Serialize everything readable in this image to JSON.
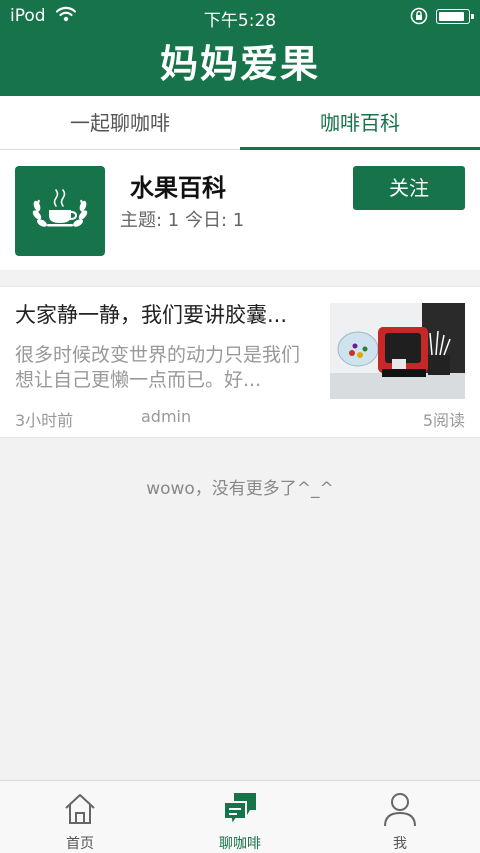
{
  "status_bar": {
    "carrier": "iPod",
    "time": "下午5:28",
    "wifi_icon": "wifi-icon",
    "lock_icon": "rotation-lock-icon",
    "battery_level": 0.9
  },
  "header": {
    "title": "妈妈爱果"
  },
  "tabs": [
    {
      "label": "一起聊咖啡",
      "active": false
    },
    {
      "label": "咖啡百科",
      "active": true
    }
  ],
  "forum": {
    "name": "水果百科",
    "stats": "主题: 1   今日: 1",
    "follow_label": "关注",
    "logo_icon": "coffee-laurel-icon"
  },
  "articles": [
    {
      "title": "大家静一静，我们要讲胶囊...",
      "excerpt": "很多时候改变世界的动力只是我们想让自己更懒一点而已。好...",
      "time": "3小时前",
      "author": "admin",
      "reads": "5阅读"
    }
  ],
  "list_end_text": "wowo，没有更多了^_^",
  "tabbar": [
    {
      "label": "首页",
      "icon": "home-icon",
      "active": false
    },
    {
      "label": "聊咖啡",
      "icon": "chat-bubbles-icon",
      "active": true
    },
    {
      "label": "我",
      "icon": "person-icon",
      "active": false
    }
  ],
  "colors": {
    "brand": "#16734a",
    "background": "#f2f2f2"
  }
}
